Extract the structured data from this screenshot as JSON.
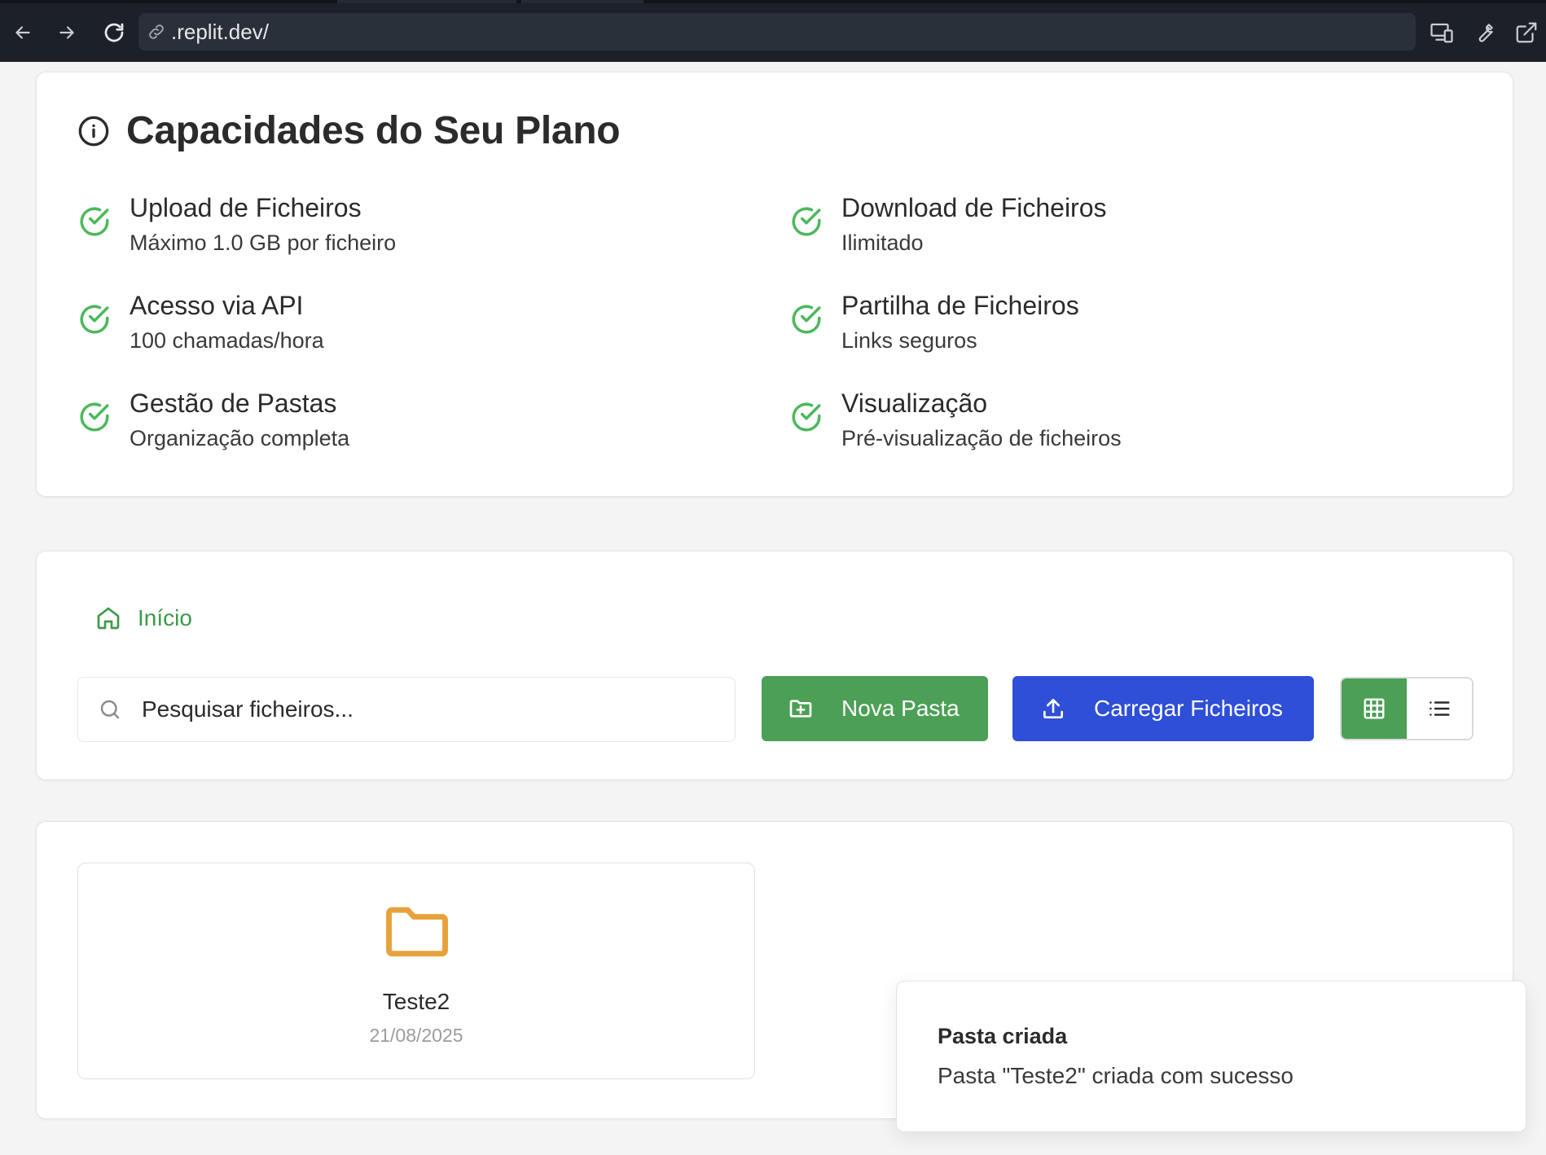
{
  "browser": {
    "url": ".replit.dev/"
  },
  "capabilities": {
    "title": "Capacidades do Seu Plano",
    "features": [
      {
        "title": "Upload de Ficheiros",
        "subtitle": "Máximo 1.0 GB por ficheiro"
      },
      {
        "title": "Download de Ficheiros",
        "subtitle": "Ilimitado"
      },
      {
        "title": "Acesso via API",
        "subtitle": "100 chamadas/hora"
      },
      {
        "title": "Partilha de Ficheiros",
        "subtitle": "Links seguros"
      },
      {
        "title": "Gestão de Pastas",
        "subtitle": "Organização completa"
      },
      {
        "title": "Visualização",
        "subtitle": "Pré-visualização de ficheiros"
      }
    ]
  },
  "toolbar": {
    "breadcrumb_home": "Início",
    "search_placeholder": "Pesquisar ficheiros...",
    "new_folder_label": "Nova Pasta",
    "upload_label": "Carregar Ficheiros",
    "active_view": "grid"
  },
  "files": [
    {
      "name": "Teste2",
      "date": "21/08/2025",
      "type": "folder"
    }
  ],
  "toast": {
    "title": "Pasta criada",
    "message": "Pasta \"Teste2\" criada com sucesso"
  },
  "colors": {
    "accent_green": "#4ba055",
    "accent_blue": "#2f4fd8",
    "folder": "#e8a23c",
    "check": "#4cb85c"
  }
}
